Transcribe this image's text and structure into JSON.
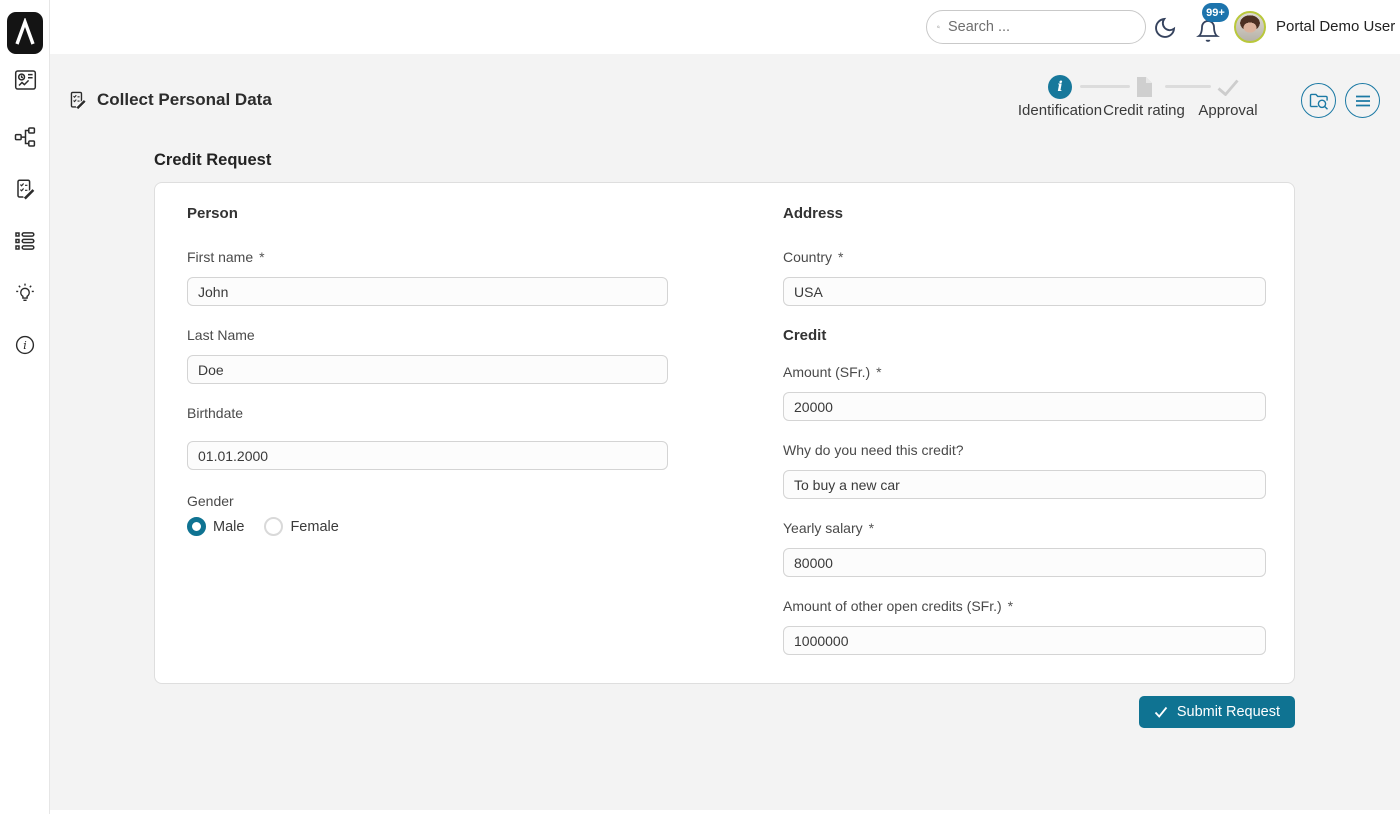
{
  "topbar": {
    "search_placeholder": "Search ...",
    "notification_count": "99+",
    "user_name": "Portal Demo User",
    "icons": [
      "search-icon",
      "dark-mode-moon-icon",
      "notification-bell-icon"
    ]
  },
  "sidebar": {
    "icons": [
      "app-logo",
      "dashboard-icon",
      "processes-icon",
      "tasks-icon",
      "cases-icon",
      "lightbulb-icon",
      "info-icon"
    ]
  },
  "header": {
    "title": "Collect Personal Data",
    "steps": [
      {
        "label": "Identification",
        "state": "active",
        "icon": "info-circle-icon"
      },
      {
        "label": "Credit rating",
        "state": "upcoming",
        "icon": "file-icon"
      },
      {
        "label": "Approval",
        "state": "upcoming",
        "icon": "check-icon"
      }
    ],
    "actions": [
      "process-viewer-button",
      "case-menu-button"
    ]
  },
  "form": {
    "title": "Credit Request",
    "sections": {
      "person": {
        "heading": "Person",
        "first_name": {
          "label": "First name",
          "required": "*",
          "value": "John"
        },
        "last_name": {
          "label": "Last Name",
          "value": "Doe"
        },
        "birthdate": {
          "label": "Birthdate",
          "value": "01.01.2000"
        },
        "gender": {
          "label": "Gender",
          "options": [
            {
              "label": "Male"
            },
            {
              "label": "Female"
            }
          ],
          "selected": "Male"
        }
      },
      "address": {
        "heading": "Address",
        "country": {
          "label": "Country",
          "required": "*",
          "value": "USA"
        }
      },
      "credit": {
        "heading": "Credit",
        "amount": {
          "label": "Amount (SFr.)",
          "required": "*",
          "value": "20000"
        },
        "reason": {
          "label": "Why do you need this credit?",
          "value": "To buy a new car"
        },
        "salary": {
          "label": "Yearly salary",
          "required": "*",
          "value": "80000"
        },
        "other_credits": {
          "label": "Amount of other open credits (SFr.)",
          "required": "*",
          "value": "1000000"
        }
      }
    },
    "submit_label": "Submit Request"
  },
  "colors": {
    "primary": "#0f7392",
    "step_active": "#17789b",
    "badge": "#1d74ad",
    "avatar_ring": "#b9c83b",
    "main_background": "#f3f3f3"
  }
}
